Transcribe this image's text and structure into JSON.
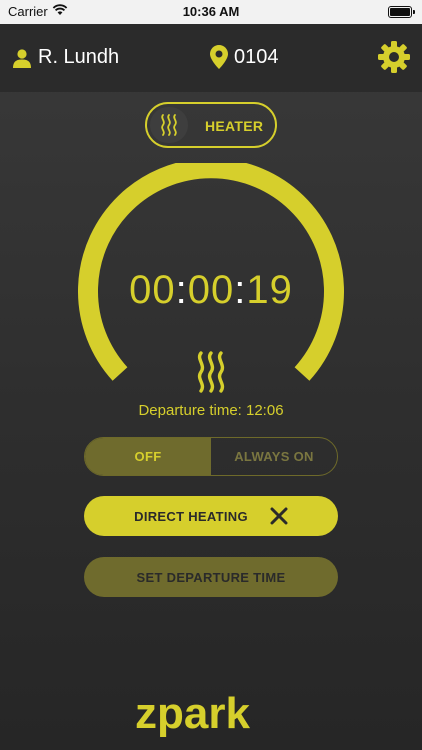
{
  "status_bar": {
    "carrier": "Carrier",
    "time": "10:36 AM"
  },
  "header": {
    "user_name": "R. Lundh",
    "location": "0104"
  },
  "mode": {
    "label": "HEATER"
  },
  "timer": {
    "hh": "00",
    "mm": "00",
    "ss": "19",
    "sep": ":"
  },
  "departure": {
    "text": "Departure time: 12:06"
  },
  "toggle": {
    "off_label": "OFF",
    "on_label": "ALWAYS ON",
    "selected": "OFF"
  },
  "actions": {
    "direct_heating": "DIRECT HEATING",
    "set_departure": "SET DEPARTURE TIME"
  },
  "brand": {
    "name": "zpark"
  },
  "colors": {
    "accent": "#d6cf2c",
    "accent_dim": "#6f6b2d",
    "background": "#323232",
    "header": "#2b2b2b"
  },
  "icons": [
    "wifi-icon",
    "battery-icon",
    "user-icon",
    "location-pin-icon",
    "gear-icon",
    "heat-waves-icon",
    "close-icon"
  ]
}
